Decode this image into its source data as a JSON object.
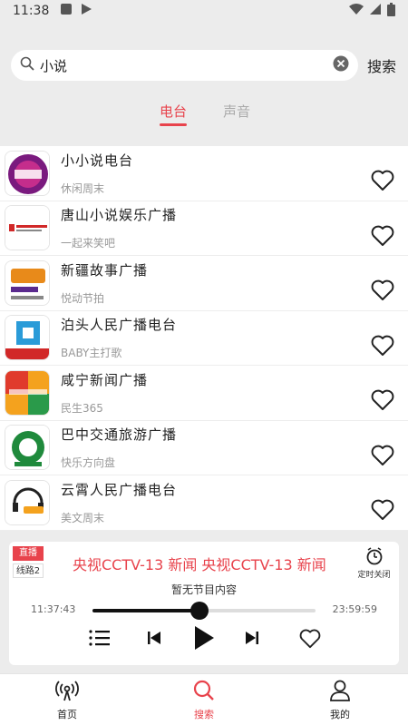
{
  "status_bar": {
    "time": "11:38"
  },
  "search": {
    "query": "小说",
    "button_label": "搜索"
  },
  "tabs": [
    {
      "label": "电台",
      "active": true
    },
    {
      "label": "声音",
      "active": false
    }
  ],
  "stations": [
    {
      "title": "小小说电台",
      "subtitle": "休闲周末",
      "logo_icon": "purple-badge-logo"
    },
    {
      "title": "唐山小说娱乐广播",
      "subtitle": "一起来笑吧",
      "logo_icon": "red-banner-logo"
    },
    {
      "title": "新疆故事广播",
      "subtitle": "悦动节拍",
      "logo_icon": "fm1028-logo"
    },
    {
      "title": "泊头人民广播电台",
      "subtitle": "BABY主打歌",
      "logo_icon": "blue-red-logo"
    },
    {
      "title": "咸宁新闻广播",
      "subtitle": "民生365",
      "logo_icon": "colorful-calligraphy-logo"
    },
    {
      "title": "巴中交通旅游广播",
      "subtitle": "快乐方向盘",
      "logo_icon": "fm94-green-logo"
    },
    {
      "title": "云霄人民广播电台",
      "subtitle": "美文周末",
      "logo_icon": "fm92-headphones-logo"
    }
  ],
  "player": {
    "live_label": "直播",
    "line_label": "线路2",
    "marquee_text": "央视CCTV-13 新闻    央视CCTV-13 新闻",
    "timer_label": "定时关闭",
    "now_playing": "暂无节目内容",
    "start_time": "11:37:43",
    "end_time": "23:59:59",
    "progress_fraction": 0.48
  },
  "bottom_nav": [
    {
      "label": "首页",
      "icon": "radio-icon",
      "active": false
    },
    {
      "label": "搜索",
      "icon": "search-icon",
      "active": true
    },
    {
      "label": "我的",
      "icon": "user-icon",
      "active": false
    }
  ],
  "colors": {
    "accent": "#e8434c",
    "background": "#ececec"
  }
}
